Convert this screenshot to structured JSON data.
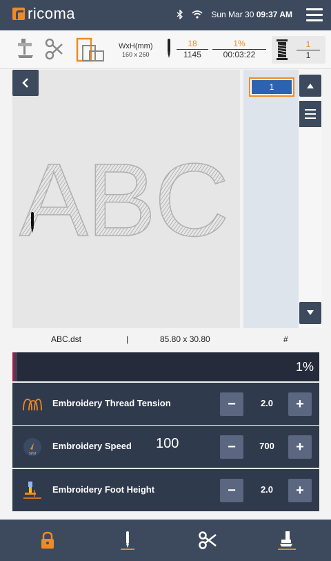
{
  "app": {
    "logo_text": "ricoma"
  },
  "status_bar": {
    "date": "Sun Mar 30",
    "time": "09:37 AM"
  },
  "info_bar": {
    "size_label": "WxH(mm)",
    "size_value": "160 x 260",
    "stitch_current": "18",
    "stitch_total": "1145",
    "progress_percent": "1%",
    "elapsed_time": "00:03:22",
    "thread_current": "1",
    "thread_total": "1"
  },
  "design": {
    "preview_text": "ABC"
  },
  "color_list": {
    "items": [
      "1"
    ],
    "colors": [
      "#2c62b0"
    ]
  },
  "file_info": {
    "filename": "ABC.dst",
    "separator": "|",
    "dimensions": "85.80 x 30.80",
    "hash": "#"
  },
  "progress": {
    "label": "1%",
    "fraction": 0.01
  },
  "controls": {
    "tension": {
      "label": "Embroidery Thread Tension",
      "value": "2.0"
    },
    "speed": {
      "label": "Embroidery Speed",
      "extra": "100",
      "value": "700",
      "icon_text": "SPM"
    },
    "foot_height": {
      "label": "Embroidery Foot Height",
      "value": "2.0"
    }
  },
  "theme": {
    "accent": "#f08a24",
    "navy": "#3d4a5d",
    "row_bg": "#303a4d",
    "button_bg": "#5b6680"
  }
}
